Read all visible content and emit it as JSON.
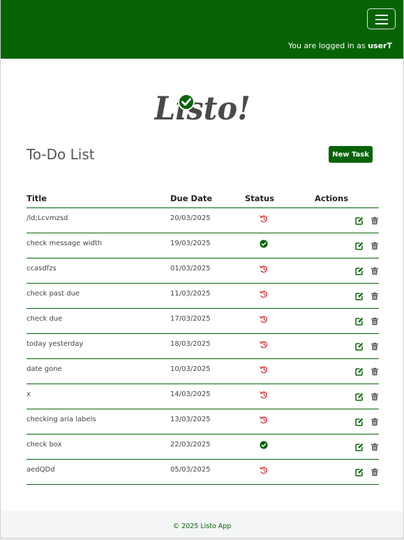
{
  "header": {
    "login_prefix": "You are logged in as ",
    "username": "userT",
    "menu_icon": "hamburger-icon"
  },
  "logo": {
    "text": "Listo!",
    "icon": "check-circle-icon"
  },
  "main": {
    "title": "To-Do List",
    "new_task_label": "New Task",
    "columns": {
      "title": "Title",
      "due": "Due Date",
      "status": "Status",
      "actions": "Actions"
    },
    "tasks": [
      {
        "title": "/ld;Lcvmzsd",
        "due": "20/03/2025",
        "status": "overdue"
      },
      {
        "title": "check message width",
        "due": "19/03/2025",
        "status": "done"
      },
      {
        "title": "ccasdfzs",
        "due": "01/03/2025",
        "status": "overdue"
      },
      {
        "title": "check past due",
        "due": "11/03/2025",
        "status": "overdue"
      },
      {
        "title": "check due",
        "due": "17/03/2025",
        "status": "overdue"
      },
      {
        "title": "today yesterday",
        "due": "18/03/2025",
        "status": "overdue"
      },
      {
        "title": "date gone",
        "due": "10/03/2025",
        "status": "overdue"
      },
      {
        "title": "x",
        "due": "14/03/2025",
        "status": "overdue"
      },
      {
        "title": "checking aria labels",
        "due": "13/03/2025",
        "status": "overdue"
      },
      {
        "title": "check box",
        "due": "22/03/2025",
        "status": "done"
      },
      {
        "title": "aedQDd",
        "due": "05/03/2025",
        "status": "overdue"
      }
    ]
  },
  "footer": {
    "text": "© 2025 Listo App"
  },
  "colors": {
    "brand": "#066304",
    "overdue": "#d9363e",
    "done": "#066304"
  }
}
